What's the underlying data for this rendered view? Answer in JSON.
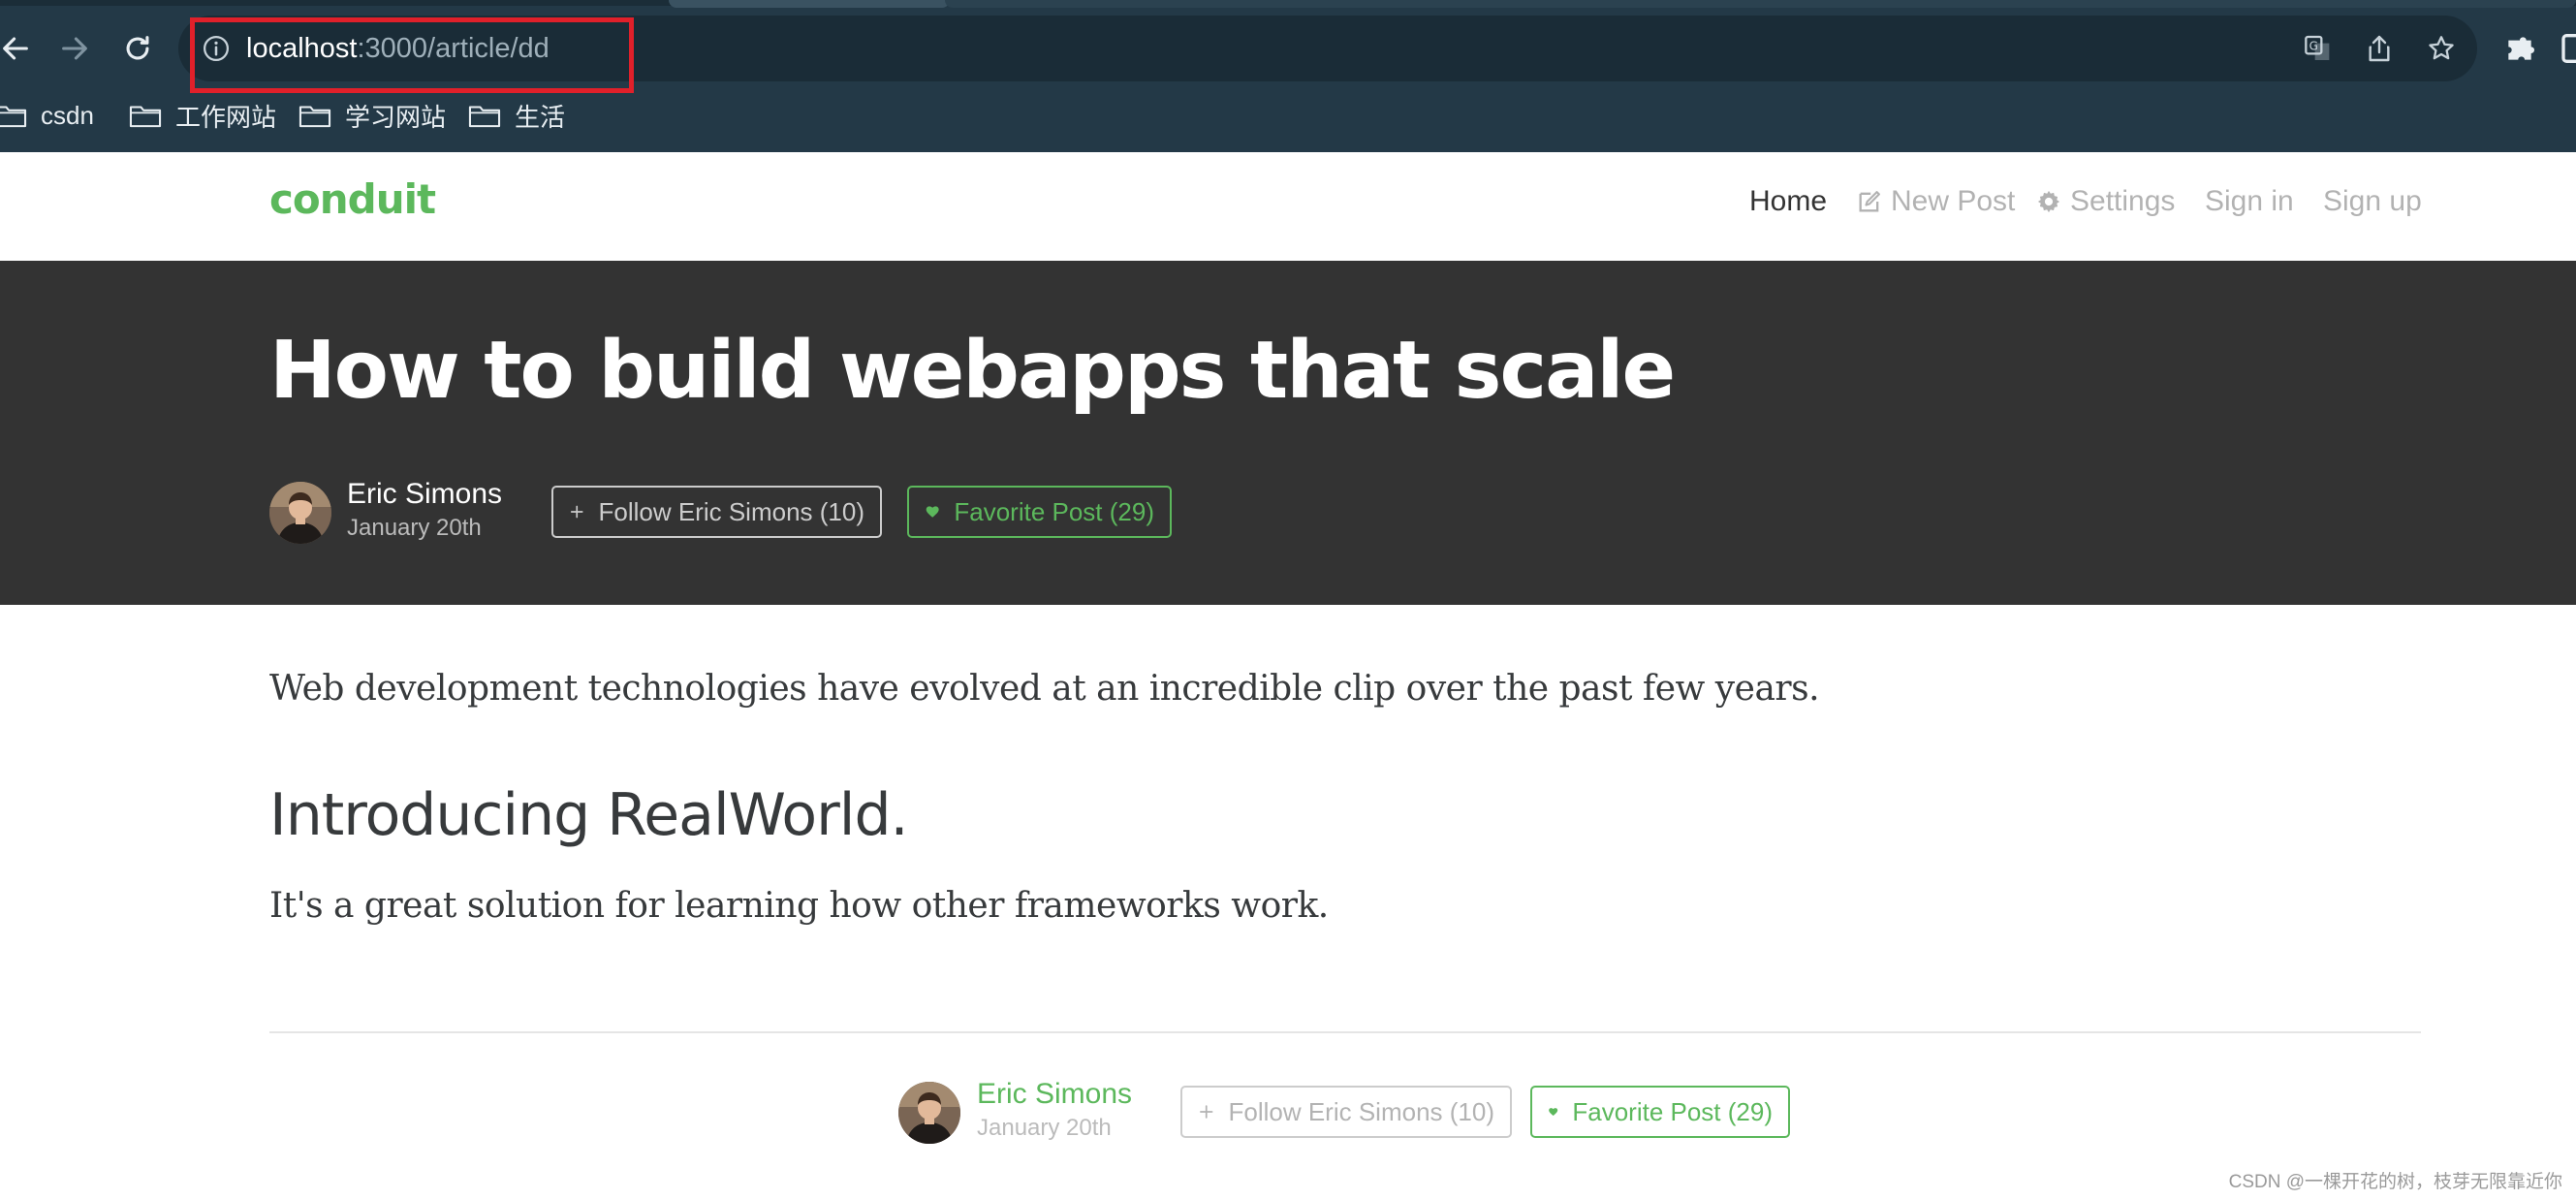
{
  "browser": {
    "url_host": "localhost",
    "url_path": ":3000/article/dd",
    "bookmarks": [
      {
        "label": "csdn"
      },
      {
        "label": "工作网站"
      },
      {
        "label": "学习网站"
      },
      {
        "label": "生活"
      }
    ]
  },
  "navbar": {
    "brand": "conduit",
    "links": [
      {
        "label": "Home",
        "icon": ""
      },
      {
        "label": "New Post",
        "icon": "edit-icon"
      },
      {
        "label": "Settings",
        "icon": "gear-icon"
      },
      {
        "label": "Sign in",
        "icon": ""
      },
      {
        "label": "Sign up",
        "icon": ""
      }
    ]
  },
  "article": {
    "title": "How to build webapps that scale",
    "author": "Eric Simons",
    "date": "January 20th",
    "follow_label": "Follow Eric Simons (10)",
    "favorite_label": "Favorite Post (29)",
    "intro": "Web development technologies have evolved at an incredible clip over the past few years.",
    "heading": "Introducing RealWorld.",
    "paragraph": "It's a great solution for learning how other frameworks work."
  },
  "footer_meta": {
    "author": "Eric Simons",
    "date": "January 20th",
    "follow_label": "Follow Eric Simons (10)",
    "favorite_label": "Favorite Post (29)"
  },
  "watermark": "CSDN @一棵开花的树，枝芽无限靠近你",
  "colors": {
    "brand": "#5cb85c",
    "banner": "#333333",
    "chrome": "#233947",
    "highlight": "#e0202a"
  }
}
